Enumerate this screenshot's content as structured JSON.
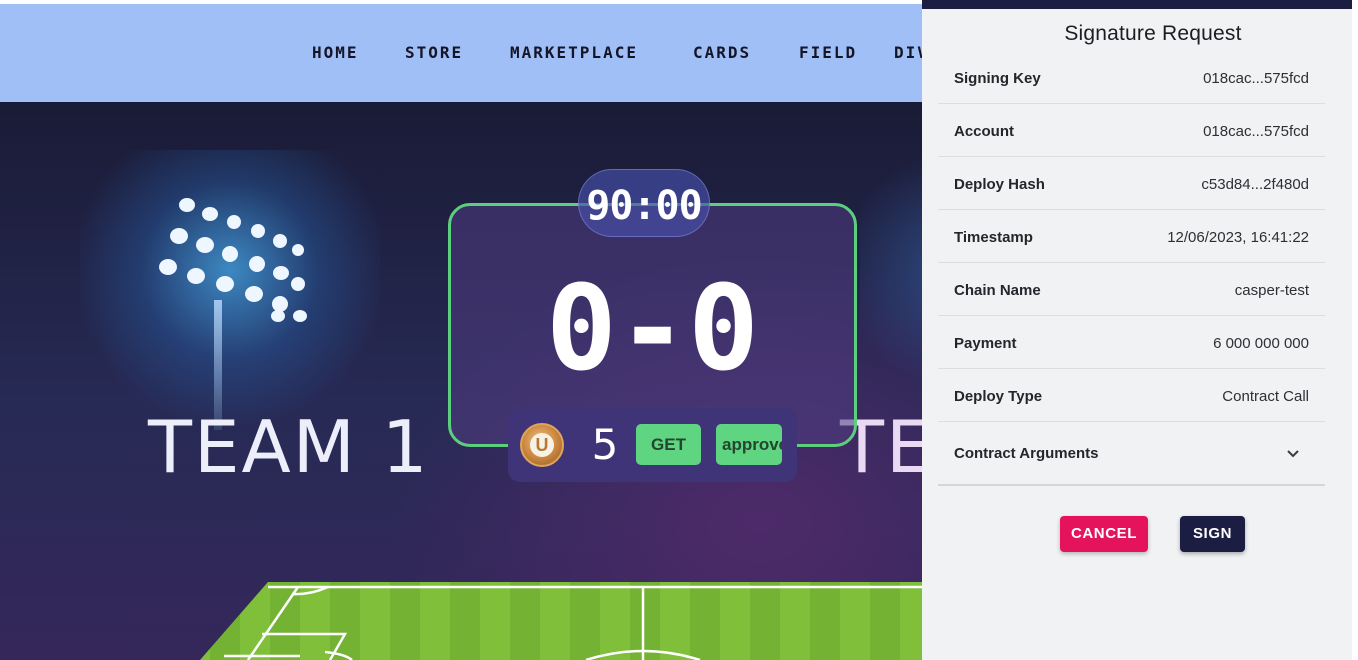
{
  "nav": {
    "items": [
      "HOME",
      "STORE",
      "MARKETPLACE",
      "CARDS",
      "FIELD",
      "DIV"
    ]
  },
  "game": {
    "timer": "90:00",
    "score": "0-0",
    "team1": "TEAM 1",
    "team2": "TE",
    "coin_symbol": "U",
    "coin_count": "5",
    "get_label": "GET",
    "approve_label": "approve"
  },
  "panel": {
    "title": "Signature Request",
    "rows": [
      {
        "label": "Signing Key",
        "value": "018cac...575fcd"
      },
      {
        "label": "Account",
        "value": "018cac...575fcd"
      },
      {
        "label": "Deploy Hash",
        "value": "c53d84...2f480d"
      },
      {
        "label": "Timestamp",
        "value": "12/06/2023, 16:41:22"
      },
      {
        "label": "Chain Name",
        "value": "casper-test"
      },
      {
        "label": "Payment",
        "value": "6 000 000 000"
      },
      {
        "label": "Deploy Type",
        "value": "Contract Call"
      }
    ],
    "contract_args_label": "Contract Arguments",
    "cancel_label": "CANCEL",
    "sign_label": "SIGN"
  },
  "colors": {
    "navbar": "#a0bff7",
    "panel_bg": "#f1f2f4",
    "panel_dark": "#1c1d42",
    "cancel": "#e5135b",
    "green": "#5fd481",
    "scoreboard_border": "#5ccf7e"
  },
  "icons": {
    "coin": "coin-icon",
    "chevron": "chevron-down-icon",
    "floodlight": "floodlight-icon"
  }
}
